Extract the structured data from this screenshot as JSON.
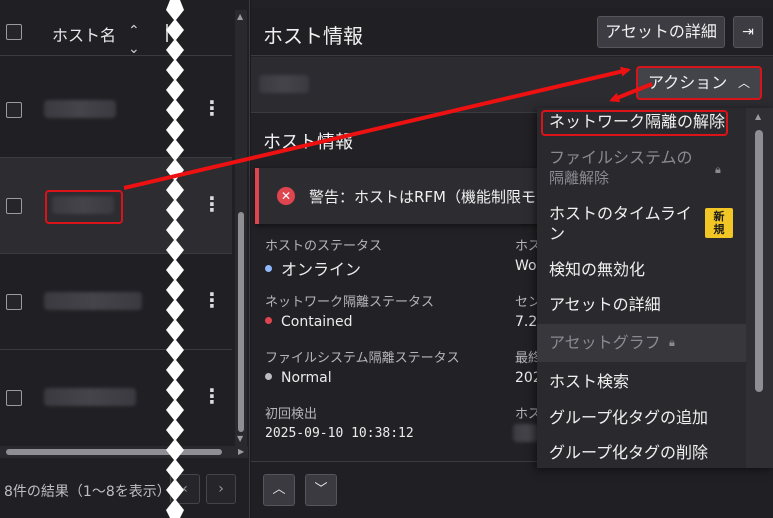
{
  "table": {
    "column_host_name": "ホスト名",
    "footer_text": "8件の結果（1～8を表示）"
  },
  "detail": {
    "title": "ホスト情報",
    "asset_detail_button": "アセットの詳細",
    "section_title": "ホスト情報",
    "alert_text": "警告：ホストはRFM（機能制限モ",
    "fields": {
      "status_label": "ホストのステータス",
      "status_value": "オンライン",
      "network_isolation_label": "ネットワーク隔離ステータス",
      "network_isolation_value": "Contained",
      "fs_isolation_label": "ファイルシステム隔離ステータス",
      "fs_isolation_value": "Normal",
      "first_seen_label": "初回検出",
      "first_seen_value": "2025-09-10 10:38:12",
      "right_col_label_1": "ホス",
      "right_col_value_1": "Wo",
      "right_col_label_2": "セン",
      "right_col_value_2": "7.2",
      "right_col_label_3": "最終",
      "right_col_value_3": "202",
      "right_col_label_4": "ホス"
    }
  },
  "action_menu": {
    "button_label": "アクション",
    "items": [
      {
        "label": "ネットワーク隔離の解除",
        "state": "highlighted"
      },
      {
        "label_line1": "ファイルシステムの",
        "label_line2": "隔離解除",
        "state": "disabled"
      },
      {
        "label_line1": "ホストのタイムライ",
        "label_line2": "ン",
        "badge_line1": "新",
        "badge_line2": "規",
        "state": "enabled"
      },
      {
        "label": "検知の無効化",
        "state": "enabled"
      },
      {
        "label": "アセットの詳細",
        "state": "enabled"
      },
      {
        "label": "アセットグラフ",
        "state": "disabled"
      },
      {
        "label": "ホスト検索",
        "state": "enabled"
      },
      {
        "label": "グループ化タグの追加",
        "state": "enabled"
      },
      {
        "label": "グループ化タグの削除",
        "state": "enabled"
      }
    ]
  },
  "icons": {
    "sort": "sort-icon",
    "kebab": "kebab-menu-icon",
    "panel_toggle": "panel-collapse-icon",
    "chevron_up": "chevron-up-icon",
    "lock": "lock-icon",
    "error": "error-circle-icon"
  },
  "colors": {
    "status_online": "#8fb8ff",
    "contained": "#e0454f",
    "normal": "#bdbdbd",
    "annotation_red": "#d8141a",
    "new_badge": "#f2c624"
  }
}
